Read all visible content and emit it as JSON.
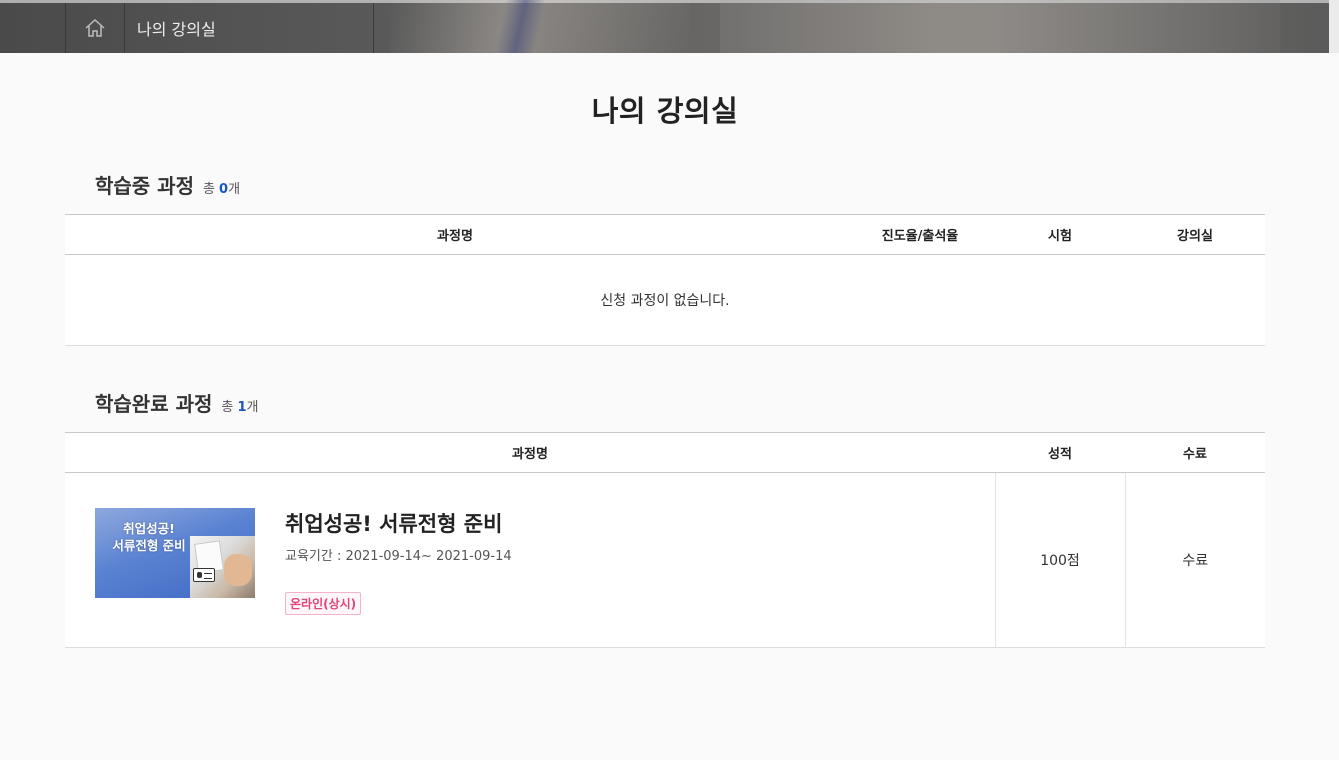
{
  "breadcrumb": {
    "home_icon": "home-icon",
    "current": "나의 강의실"
  },
  "page_title": "나의 강의실",
  "in_progress": {
    "title": "학습중 과정",
    "count_prefix": "총 ",
    "count": "0",
    "count_suffix": "개",
    "columns": [
      "과정명",
      "진도율/출석율",
      "시험",
      "강의실"
    ],
    "empty_message": "신청 과정이 없습니다."
  },
  "completed": {
    "title": "학습완료 과정",
    "count_prefix": "총 ",
    "count": "1",
    "count_suffix": "개",
    "columns": [
      "과정명",
      "성적",
      "수료"
    ],
    "rows": [
      {
        "thumbnail_text_line1": "취업성공!",
        "thumbnail_text_line2": "서류전형 준비",
        "title": "취업성공! 서류전형 준비",
        "period": "교육기간 : 2021-09-14~ 2021-09-14",
        "tag": "온라인(상시)",
        "score": "100점",
        "status": "수료"
      }
    ]
  },
  "colors": {
    "accent_blue": "#1a56c4",
    "tag_pink": "#e0457b"
  }
}
